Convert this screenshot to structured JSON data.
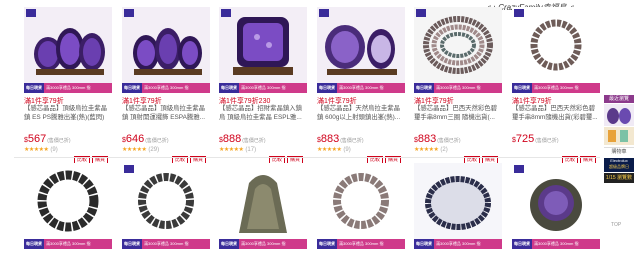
{
  "brand": {
    "text": "♫♪ CrazyFamily幸福鳥 ♫"
  },
  "row1": [
    {
      "banner_left": "每日現貨 20名",
      "banner_right": "滿3000享禮品 300mm 指",
      "promo": "滿1件享79折",
      "title": "【感芯晶品】頂級烏拉圭紫晶鎮 ES PS騰雅出峯(熱)(藍閃)",
      "currency": "$",
      "price": "567",
      "price_note": "(售價已折)",
      "rating_count": "(9)",
      "compare_label": "比較",
      "buy_label": "購買"
    },
    {
      "banner_left": "每日現貨 20名",
      "banner_right": "滿3000享禮品 300mm 指",
      "promo": "滿1件享79折",
      "title": "【感芯晶品】頂級烏拉圭紫晶鎮 頂射開運擺飾 ESPA騰雅...",
      "currency": "$",
      "price": "646",
      "price_note": "(售價已折)",
      "rating_count": "(29)",
      "compare_label": "比較",
      "buy_label": "購買"
    },
    {
      "banner_left": "每日現貨 20名",
      "banner_right": "滿3000享禮品 300mm 指",
      "promo": "滿1件享79折230",
      "title": "【感芯晶品】招財紫晶鎮入鎮 烏 頂級烏拉圭紫晶 ESPL雅...",
      "currency": "$",
      "price": "888",
      "price_note": "(售價已折)",
      "rating_count": "(17)",
      "compare_label": "比較",
      "buy_label": "購買"
    },
    {
      "banner_left": "每日現貨 20名",
      "banner_right": "滿3000享禮品 300mm 指",
      "promo": "滿1件享79折",
      "title": "【感芯晶品】天然烏拉圭紫晶鎮 600g以上射頭鎮出峯(熱)...",
      "currency": "$",
      "price": "883",
      "price_note": "(售價已折)",
      "rating_count": "(9)",
      "compare_label": "比較",
      "buy_label": "購買"
    },
    {
      "banner_left": "每日現貨 20名",
      "banner_right": "滿3000享禮品 300mm 指",
      "promo": "滿1件享79折",
      "title": "【感芯晶品】巴西天然彩色碧 璽手串8mm三圈 隨機出貨(...",
      "currency": "$",
      "price": "883",
      "price_note": "(售價已折)",
      "rating_count": "(2)",
      "compare_label": "比較",
      "buy_label": "購買"
    },
    {
      "banner_left": "每日現貨 20名",
      "banner_right": "滿3000享禮品 300mm 指",
      "promo": "滿1件享79折",
      "title": "【感芯晶品】巴西天然彩色碧 璽手串8mm隨機出貨(彩碧璽...",
      "currency": "$",
      "price": "725",
      "price_note": "(售價已折)",
      "rating_count": "",
      "compare_label": "比較",
      "buy_label": "購買"
    }
  ],
  "row2": [
    {
      "banner_left": "每日現貨 20名",
      "banner_right": "滿3000享禮品 300mm 指"
    },
    {
      "banner_left": "每日現貨 20名",
      "banner_right": "滿3000享禮品 300mm 指"
    },
    {
      "banner_left": "每日現貨 20名",
      "banner_right": "滿3000享禮品 300mm 指"
    },
    {
      "banner_left": "每日現貨 20名",
      "banner_right": "滿3000享禮品 300mm 指"
    },
    {
      "banner_left": "每日現貨 20名",
      "banner_right": "滿3000享禮品 300mm 指"
    },
    {
      "banner_left": "每日現貨 20名",
      "banner_right": "滿3000享禮品 300mm 指"
    }
  ],
  "sidebar": {
    "recent_label": "最近瀏覽",
    "cart_label": "購物車",
    "electrolux": "Electrolux",
    "promo_line": "超級品牌日",
    "page_indicator": "1/15",
    "view_label": "瀏覽數"
  },
  "top_link": "TOP",
  "colors": {
    "price_red": "#d0021b",
    "banner_purple": "#3a2c9a",
    "banner_pink": "#cf3a8a",
    "star": "#f5a623"
  }
}
